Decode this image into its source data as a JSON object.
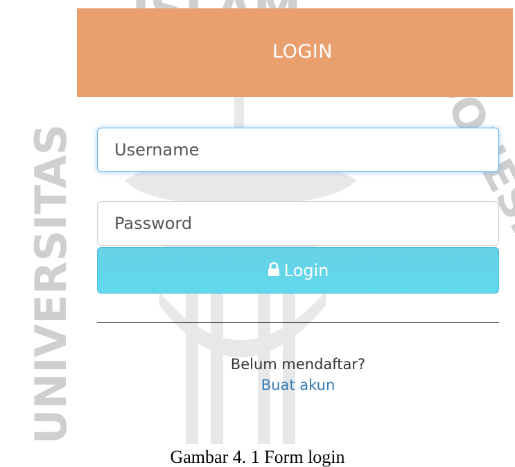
{
  "watermark": {
    "text_top": "ISLAM",
    "text_left": "UNIVERSITAS",
    "text_right": "INDONESIA"
  },
  "header": {
    "title": "LOGIN",
    "color": "#e9a06e"
  },
  "form": {
    "username_placeholder": "Username",
    "password_placeholder": "Password",
    "login_button_label": "Login",
    "login_button_icon": "lock-icon",
    "button_color": "#62d8ec",
    "focus_color": "#66afe9"
  },
  "signup": {
    "question": "Belum mendaftar?",
    "link_text": "Buat akun",
    "link_color": "#337ab7"
  },
  "caption": "Gambar 4. 1 Form login"
}
